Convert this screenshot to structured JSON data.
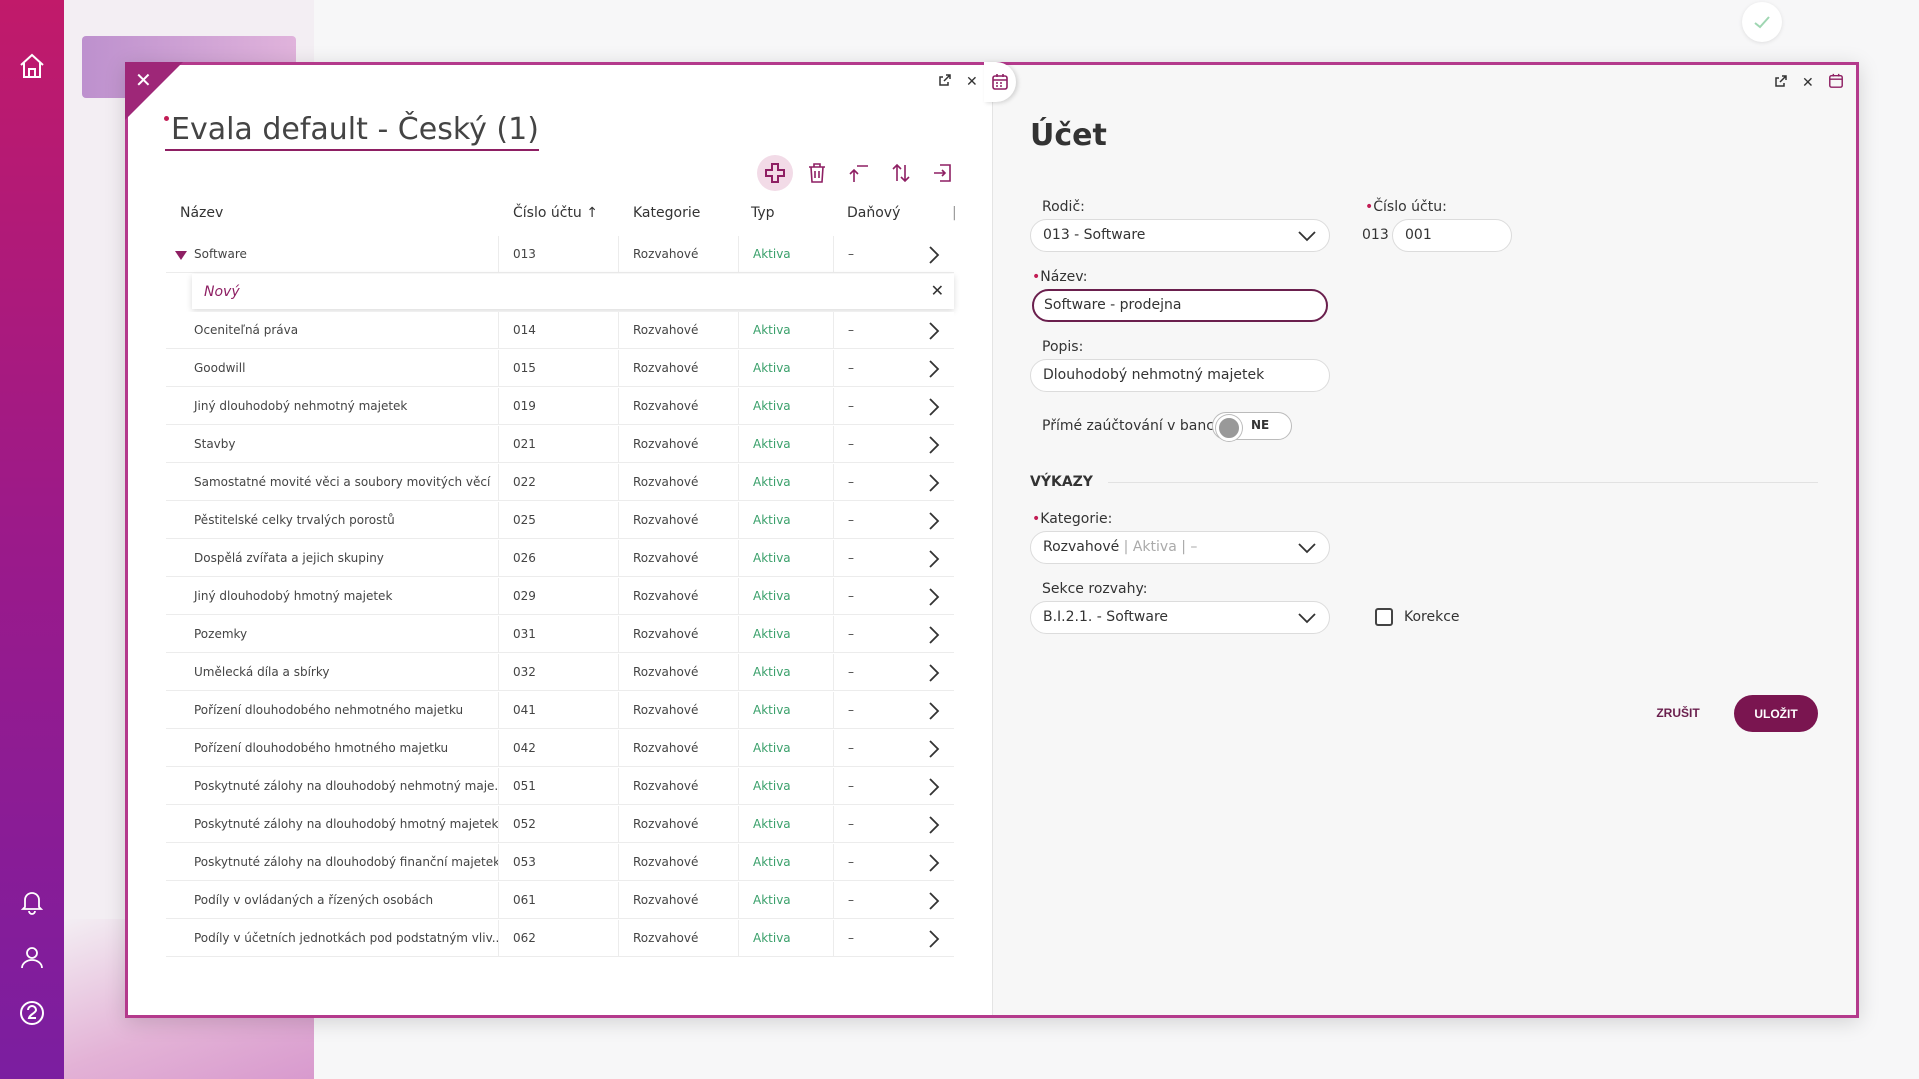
{
  "background": {
    "check_icon": "check-icon"
  },
  "left_panel": {
    "title": "Evala default - Český (1)",
    "toolbar": {
      "add_icon": "plus-icon",
      "delete_icon": "trash-icon",
      "move_up_icon": "arrow-top-icon",
      "sort_icon": "sort-icon",
      "export_icon": "export-icon"
    },
    "columns": [
      "Název",
      "Číslo účtu",
      "Kategorie",
      "Typ",
      "Daňový"
    ],
    "sort_indicator": "↑",
    "first_row": {
      "name": "Software",
      "number": "013",
      "category": "Rozvahové",
      "type": "Aktiva",
      "tax": "–"
    },
    "new_row_label": "Nový",
    "rows": [
      {
        "name": "Oceniteľná práva",
        "number": "014",
        "category": "Rozvahové",
        "type": "Aktiva",
        "tax": "–"
      },
      {
        "name": "Goodwill",
        "number": "015",
        "category": "Rozvahové",
        "type": "Aktiva",
        "tax": "–"
      },
      {
        "name": "Jiný dlouhodobý nehmotný majetek",
        "number": "019",
        "category": "Rozvahové",
        "type": "Aktiva",
        "tax": "–"
      },
      {
        "name": "Stavby",
        "number": "021",
        "category": "Rozvahové",
        "type": "Aktiva",
        "tax": "–"
      },
      {
        "name": "Samostatné movité věci a soubory movitých věcí",
        "number": "022",
        "category": "Rozvahové",
        "type": "Aktiva",
        "tax": "–"
      },
      {
        "name": "Pěstitelské celky trvalých porostů",
        "number": "025",
        "category": "Rozvahové",
        "type": "Aktiva",
        "tax": "–"
      },
      {
        "name": "Dospělá zvířata a jejich skupiny",
        "number": "026",
        "category": "Rozvahové",
        "type": "Aktiva",
        "tax": "–"
      },
      {
        "name": "Jiný dlouhodobý hmotný majetek",
        "number": "029",
        "category": "Rozvahové",
        "type": "Aktiva",
        "tax": "–"
      },
      {
        "name": "Pozemky",
        "number": "031",
        "category": "Rozvahové",
        "type": "Aktiva",
        "tax": "–"
      },
      {
        "name": "Umělecká díla a sbírky",
        "number": "032",
        "category": "Rozvahové",
        "type": "Aktiva",
        "tax": "–"
      },
      {
        "name": "Pořízení dlouhodobého nehmotného majetku",
        "number": "041",
        "category": "Rozvahové",
        "type": "Aktiva",
        "tax": "–"
      },
      {
        "name": "Pořízení dlouhodobého hmotného majetku",
        "number": "042",
        "category": "Rozvahové",
        "type": "Aktiva",
        "tax": "–"
      },
      {
        "name": "Poskytnuté zálohy na dlouhodobý nehmotný maje...",
        "number": "051",
        "category": "Rozvahové",
        "type": "Aktiva",
        "tax": "–"
      },
      {
        "name": "Poskytnuté zálohy na dlouhodobý hmotný majetek",
        "number": "052",
        "category": "Rozvahové",
        "type": "Aktiva",
        "tax": "–"
      },
      {
        "name": "Poskytnuté zálohy na dlouhodobý finanční majetek",
        "number": "053",
        "category": "Rozvahové",
        "type": "Aktiva",
        "tax": "–"
      },
      {
        "name": "Podíly v ovládaných a řízených osobách",
        "number": "061",
        "category": "Rozvahové",
        "type": "Aktiva",
        "tax": "–"
      },
      {
        "name": "Podíly v účetních jednotkách pod podstatným vliv...",
        "number": "062",
        "category": "Rozvahové",
        "type": "Aktiva",
        "tax": "–"
      }
    ]
  },
  "right_panel": {
    "title": "Účet",
    "parent_label": "Rodič:",
    "parent_value": "013 - Software",
    "account_no_label": "Číslo účtu:",
    "account_prefix": "013",
    "account_suffix": "001",
    "name_label": "Název:",
    "name_value": "Software - prodejna",
    "description_label": "Popis:",
    "description_value": "Dlouhodobý nehmotný majetek",
    "direct_posting_label": "Přímé zaúčtování v bance",
    "direct_posting_value": "NE",
    "reports_section": "VÝKAZY",
    "category_label": "Kategorie:",
    "category_value": "Rozvahové",
    "category_muted": "| Aktiva | –",
    "balance_section_label": "Sekce rozvahy:",
    "balance_section_value": "B.I.2.1. - Software",
    "correction_label": "Korekce",
    "cancel_label": "ZRUŠIT",
    "save_label": "ULOŽIT"
  },
  "colors": {
    "accent": "#7a1550",
    "frame": "#b43a8c",
    "positive": "#3aa06b",
    "required": "#c21d55"
  }
}
